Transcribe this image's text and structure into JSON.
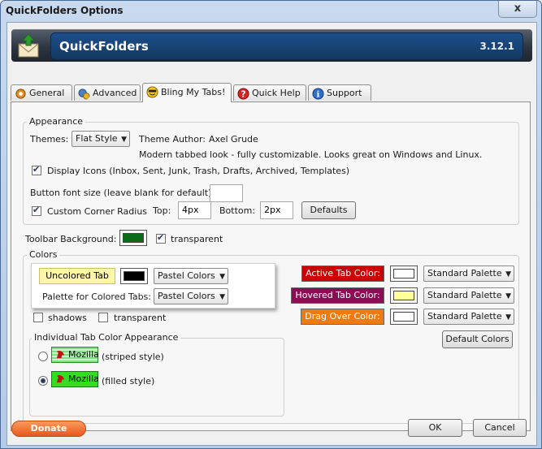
{
  "window": {
    "title": "QuickFolders Options",
    "close_label": "x"
  },
  "header": {
    "app_name": "QuickFolders",
    "version": "3.12.1"
  },
  "tabs": [
    {
      "label": "General",
      "icon": "gear-icon"
    },
    {
      "label": "Advanced",
      "icon": "gears-icon"
    },
    {
      "label": "Bling My Tabs!",
      "icon": "smiley-icon"
    },
    {
      "label": "Quick Help",
      "icon": "help-icon"
    },
    {
      "label": "Support",
      "icon": "info-icon"
    }
  ],
  "appearance": {
    "group_title": "Appearance",
    "themes_label": "Themes:",
    "theme_value": "Flat Style",
    "theme_author_label": "Theme Author:",
    "theme_author": "Axel Grude",
    "theme_description": "Modern tabbed look - fully customizable. Looks great on Windows and Linux.",
    "display_icons_label": "Display Icons (Inbox, Sent, Junk, Trash, Drafts, Archived, Templates)",
    "button_font_label": "Button font size (leave blank for default):",
    "button_font_value": "",
    "corner_radius_label": "Custom Corner Radius",
    "top_label": "Top:",
    "top_value": "4px",
    "bottom_label": "Bottom:",
    "bottom_value": "2px",
    "defaults_button": "Defaults"
  },
  "toolbar": {
    "background_label": "Toolbar Background:",
    "background_color": "#0a6b1a",
    "transparent_label": "transparent"
  },
  "colors": {
    "group_title": "Colors",
    "uncolored_tab_label": "Uncolored Tab",
    "uncolored_palette": "Pastel Colors",
    "palette_colored_label": "Palette for Colored Tabs:",
    "palette_colored_value": "Pastel Colors",
    "shadows_label": "shadows",
    "transparent_label": "transparent",
    "active_tab_label": "Active Tab Color:",
    "active_tab_bg": "#cc0000",
    "active_tab_palette": "Standard Palette",
    "hovered_tab_label": "Hovered Tab Color:",
    "hovered_tab_bg": "#8b0e55",
    "hovered_tab_palette": "Standard Palette",
    "drag_over_label": "Drag Over Color:",
    "drag_over_bg": "#f07a10",
    "drag_over_palette": "Standard Palette",
    "default_colors_button": "Default Colors",
    "individual_title": "Individual Tab Color Appearance",
    "striped_sample": "Mozilla",
    "striped_label": "(striped style)",
    "filled_sample": "Mozilla",
    "filled_label": "(filled style)"
  },
  "footer": {
    "donate": "Donate",
    "ok": "OK",
    "cancel": "Cancel"
  }
}
